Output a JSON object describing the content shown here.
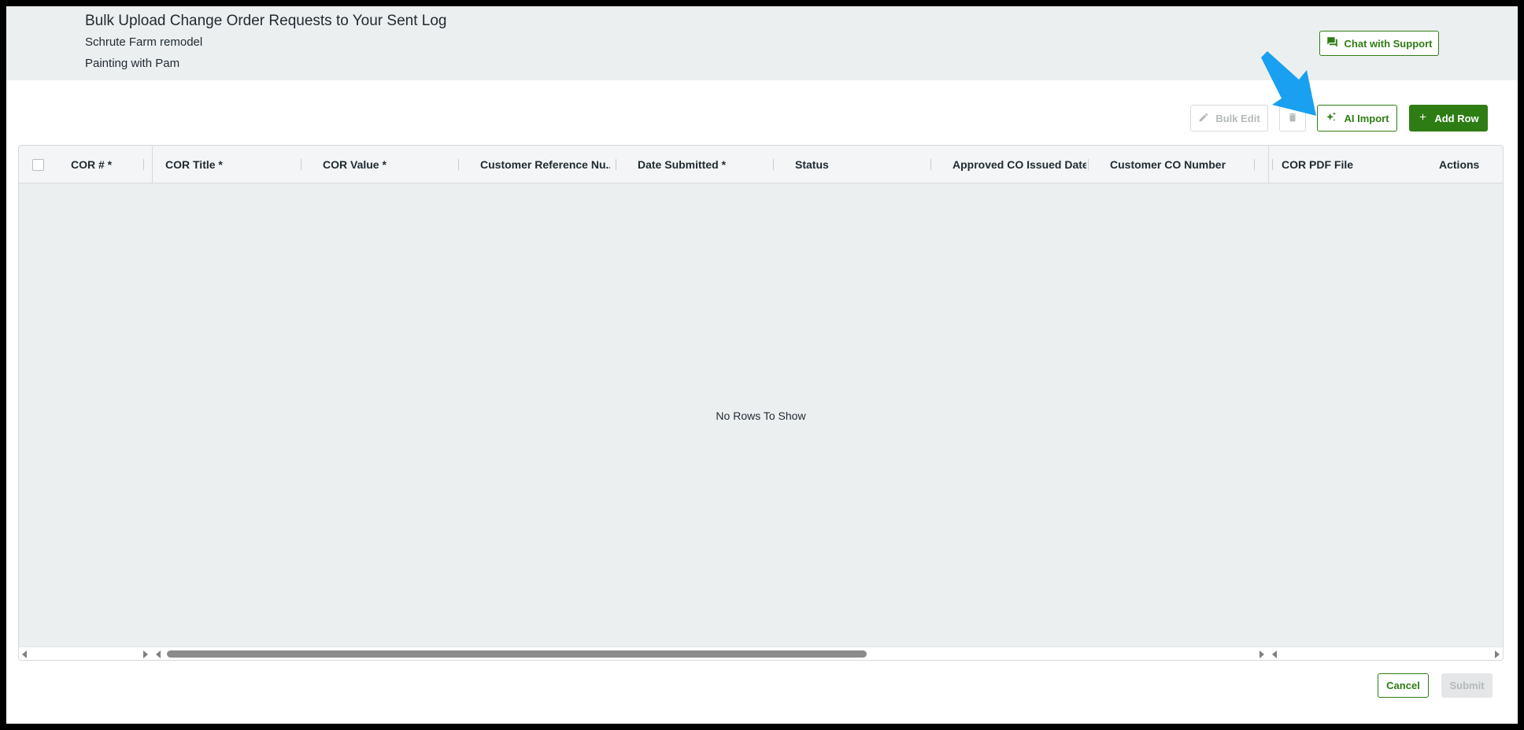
{
  "header": {
    "title": "Bulk Upload Change Order Requests to Your Sent Log",
    "project": "Schrute Farm remodel",
    "subcontract": "Painting with Pam",
    "chat_label": "Chat with Support"
  },
  "toolbar": {
    "bulk_edit_label": "Bulk Edit",
    "ai_import_label": "AI Import",
    "add_row_label": "Add Row"
  },
  "grid": {
    "columns": [
      "COR # *",
      "COR Title *",
      "COR Value *",
      "Customer Reference Nu...",
      "Date Submitted *",
      "Status",
      "Approved CO Issued Date",
      "Customer CO Number",
      "COR PDF File",
      "Actions"
    ],
    "empty_message": "No Rows To Show"
  },
  "footer": {
    "cancel_label": "Cancel",
    "submit_label": "Submit"
  },
  "colors": {
    "brand_green": "#2e7d14",
    "header_bg": "#eceff0",
    "callout_arrow": "#1aa0f0"
  },
  "icons": {
    "chat": "chat-icon",
    "bulk_edit": "pencil-icon",
    "delete": "trash-icon",
    "ai_import": "sparkle-icon",
    "add_row": "plus-icon"
  }
}
